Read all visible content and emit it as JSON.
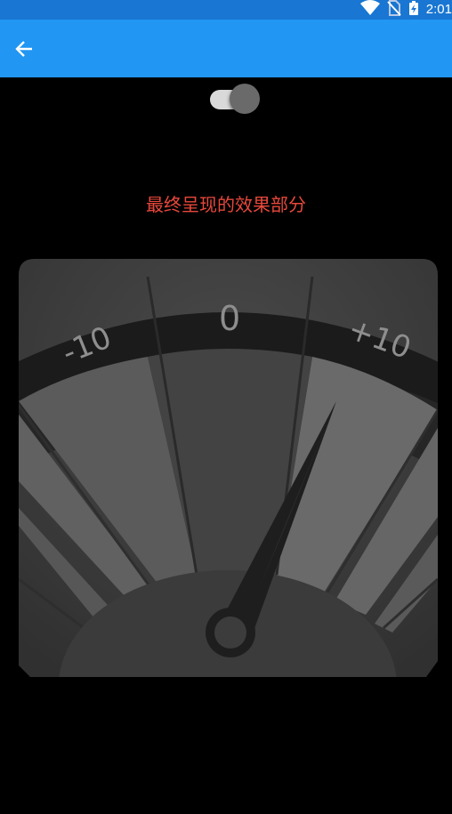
{
  "status_bar": {
    "time": "2:01",
    "icons": [
      "wifi-icon",
      "no-sim-icon",
      "battery-charging-icon"
    ],
    "background_color": "#1976D2"
  },
  "app_bar": {
    "background_color": "#2196F3",
    "back_icon": "arrow-back-icon"
  },
  "toggle": {
    "state": "on"
  },
  "caption": {
    "text": "最终呈现的效果部分",
    "color": "#E8483C"
  },
  "gauge": {
    "labels": {
      "left": "-10",
      "center": "0",
      "right": "+10"
    }
  }
}
